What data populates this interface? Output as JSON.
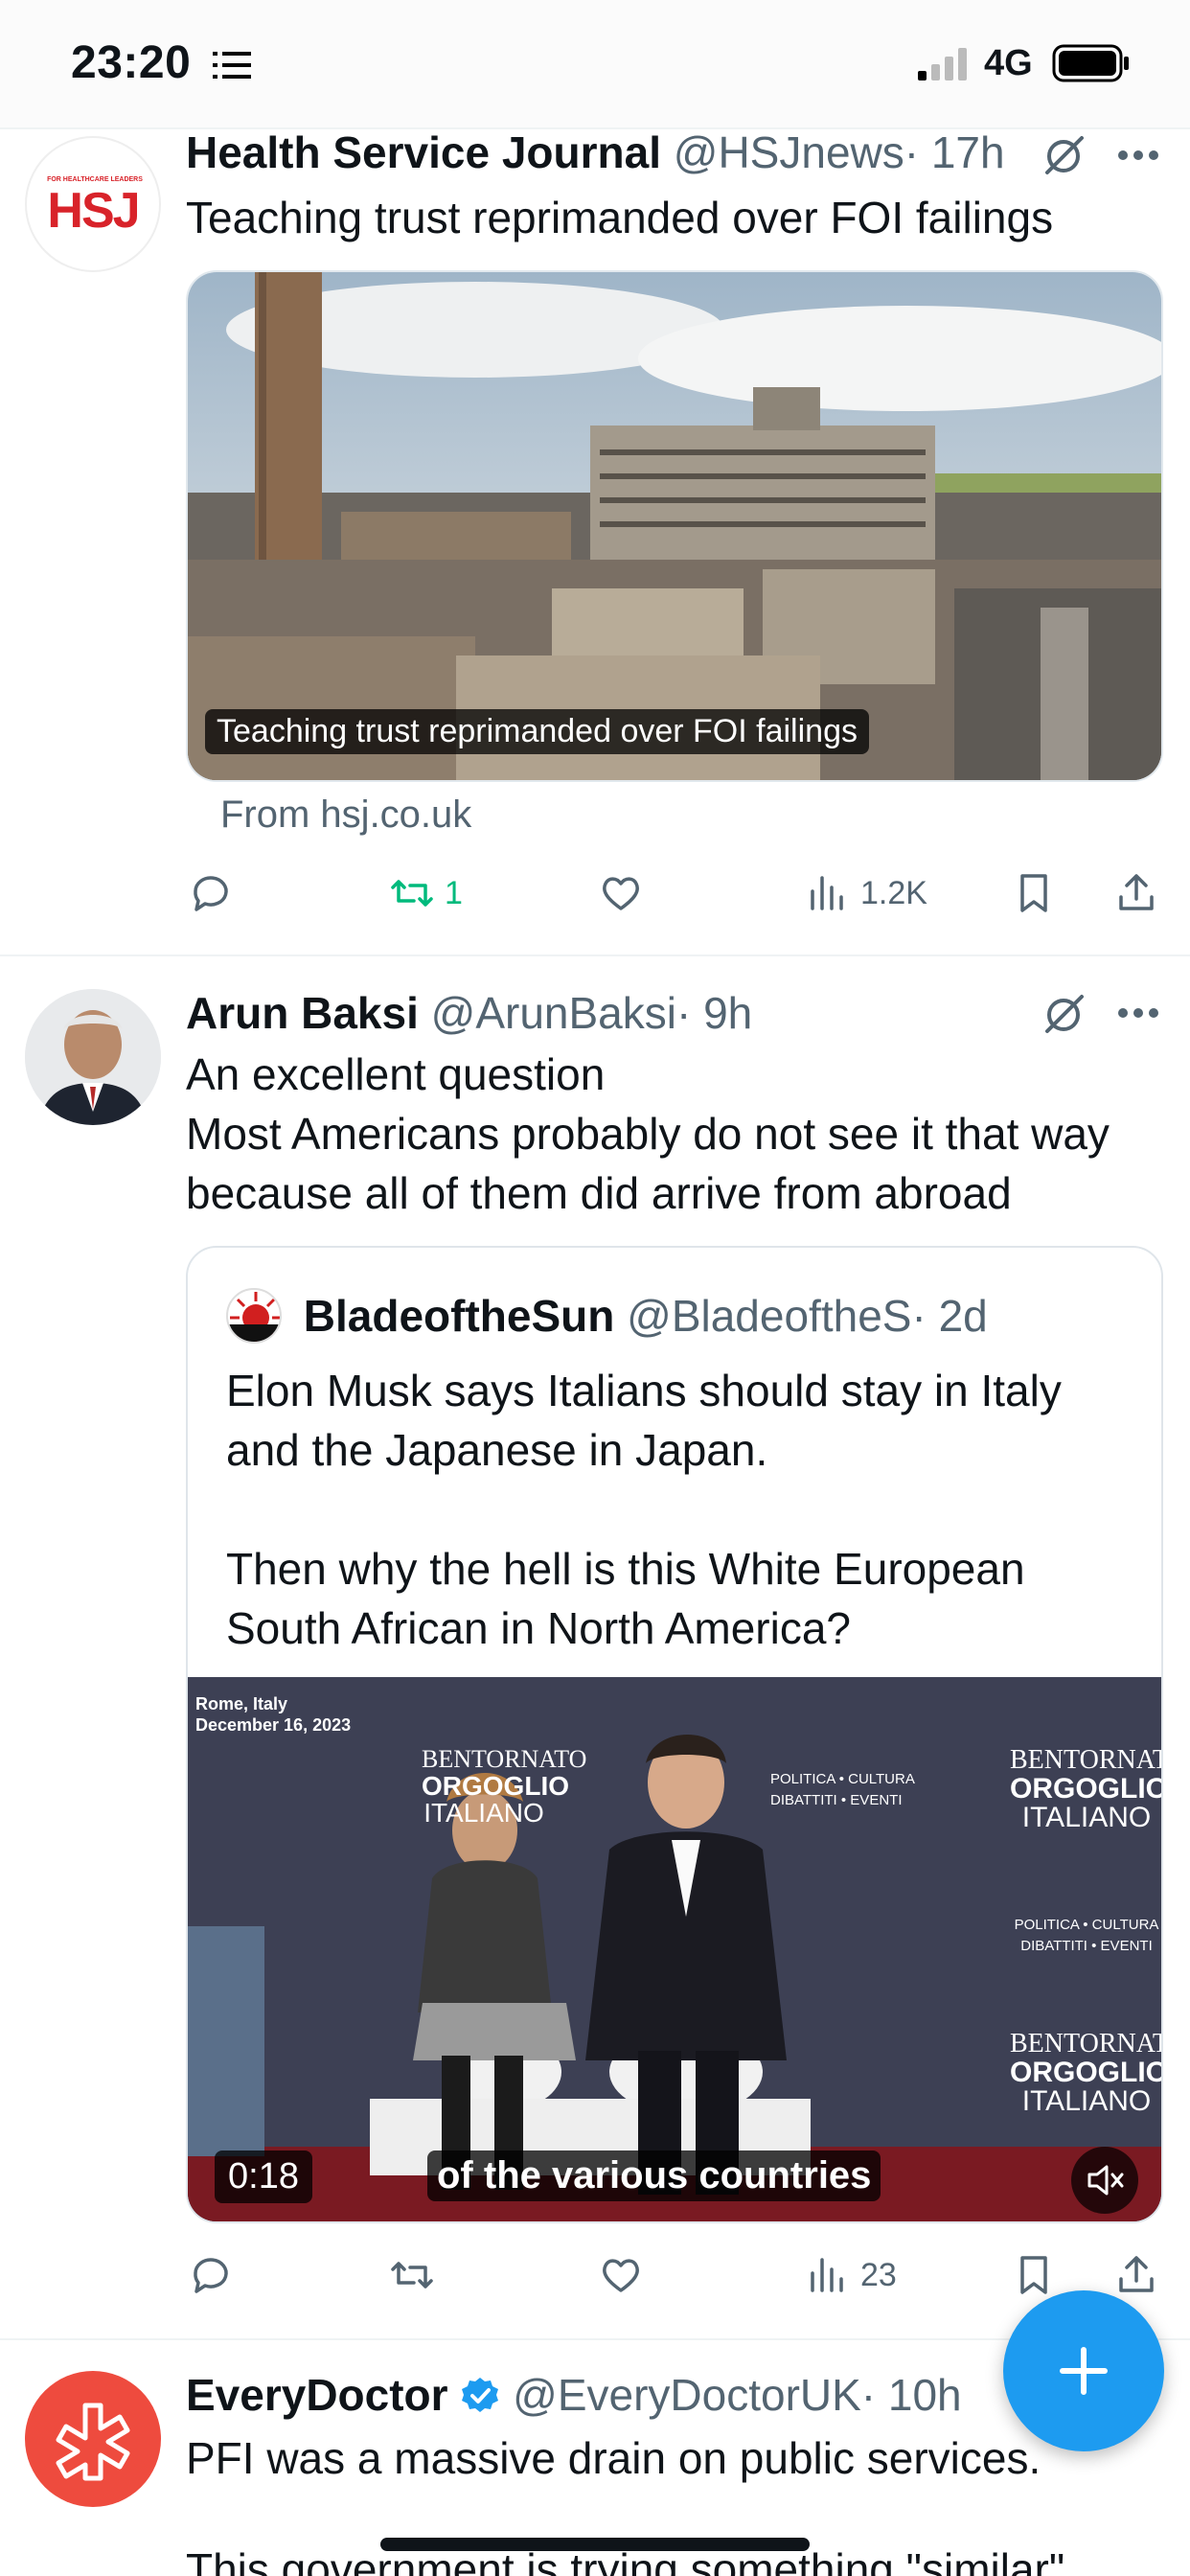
{
  "status_bar": {
    "time": "23:20",
    "network": "4G"
  },
  "tweets": [
    {
      "name": "Health Service Journal",
      "handle": "@HSJnews",
      "age": "· 17h",
      "avatar_text": "HSJ",
      "avatar_caption": "FOR HEALTHCARE LEADERS",
      "text": "Teaching trust reprimanded over FOI failings",
      "card_caption": "Teaching trust reprimanded over FOI failings",
      "source": "From hsj.co.uk",
      "reposts": "1",
      "views": "1.2K"
    },
    {
      "name": "Arun Baksi",
      "handle": "@ArunBaksi",
      "age": "· 9h",
      "text_lines": [
        "An excellent question",
        "Most Americans probably do not see it that way",
        "because all of them did arrive from abroad"
      ],
      "quote": {
        "name": "BladeoftheSun",
        "handle": "@BladeoftheS",
        "age": "· 2d",
        "text": "Elon Musk says Italians should stay in Italy\nand the Japanese in Japan.\n\nThen why the hell is this White European\nSouth African in North America?",
        "video_location": "Rome, Italy",
        "video_date": "December 16, 2023",
        "video_brand_1": "BENTORNATO",
        "video_brand_2": "ORGOGLIO",
        "video_brand_3": "ITALIANO",
        "video_tagline": "POLITICA • CULTURA",
        "video_tagline_2": "DIBATTITI • EVENTI",
        "video_duration": "0:18",
        "video_subtitle": "of the various countries"
      },
      "views": "23"
    },
    {
      "name": "EveryDoctor",
      "handle": "@EveryDoctorUK",
      "age": "· 10h",
      "text": "PFI was a massive drain on public services.",
      "text_partial": "This government is trying something \"similar\""
    }
  ],
  "colors": {
    "accent": "#1d9bf0",
    "repost_active": "#00ba7c",
    "muted": "#536471",
    "everydoctor": "#ee4b3e",
    "hsj_red": "#d8232a"
  },
  "icons": [
    "list-icon",
    "signal-icon",
    "battery-icon",
    "grok-icon",
    "more-icon",
    "reply-icon",
    "repost-icon",
    "like-icon",
    "views-icon",
    "bookmark-icon",
    "share-icon",
    "mute-icon",
    "verified-icon",
    "compose-icon"
  ]
}
